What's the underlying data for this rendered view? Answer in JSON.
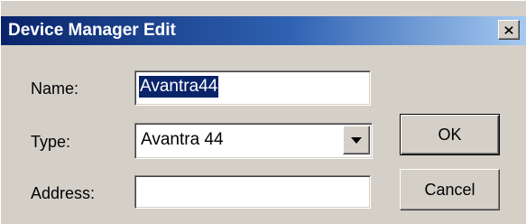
{
  "dialog": {
    "title": "Device Manager Edit",
    "close_symbol": "X"
  },
  "fields": {
    "name_label": "Name:",
    "name_value": "Avantra44",
    "type_label": "Type:",
    "type_value": "Avantra 44",
    "address_label": "Address:",
    "address_value": ""
  },
  "buttons": {
    "ok_label": "OK",
    "cancel_label": "Cancel"
  },
  "icons": {
    "close": "close-icon",
    "dropdown": "chevron-down-icon"
  },
  "colors": {
    "titlebar_start": "#0a246a",
    "titlebar_end": "#a6caf0",
    "face": "#d4d0c8",
    "selection": "#0a246a"
  }
}
